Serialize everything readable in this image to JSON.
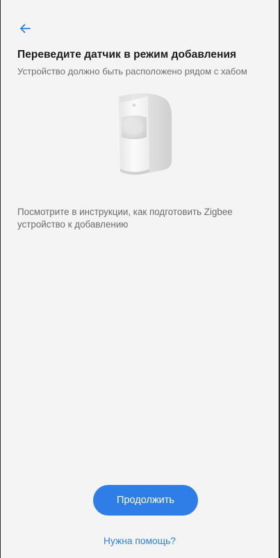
{
  "header": {
    "back_icon": "arrow-left-icon",
    "accent_color": "#2f7ee8"
  },
  "content": {
    "title": "Переведите датчик в режим добавления",
    "subtitle": "Устройство должно быть расположено рядом с хабом",
    "device_image": "motion-sensor-illustration",
    "instruction": "Посмотрите в инструкции, как подготовить Zigbee устройство к добавлению"
  },
  "actions": {
    "continue_label": "Продолжить",
    "help_label": "Нужна помощь?"
  }
}
